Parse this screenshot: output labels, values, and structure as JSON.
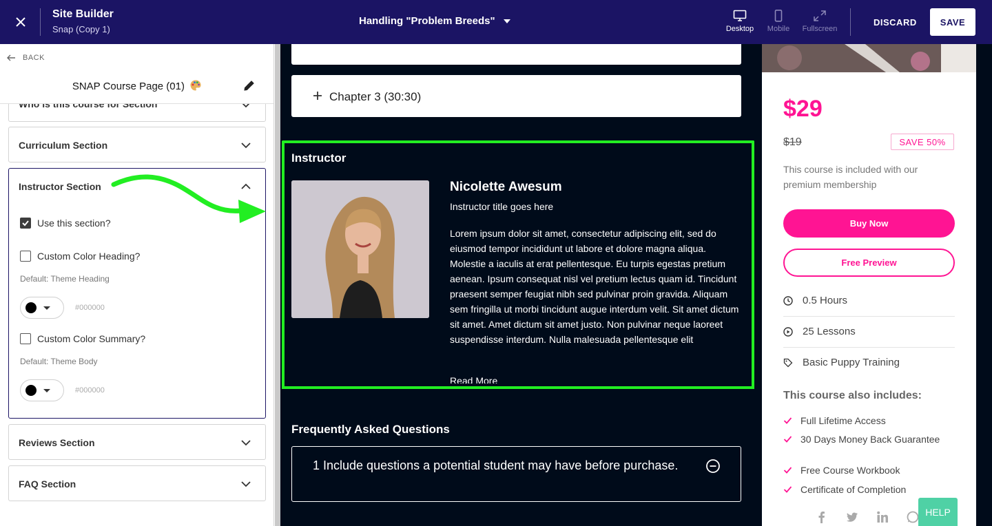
{
  "topbar": {
    "app_title": "Site Builder",
    "app_subtitle": "Snap (Copy 1)",
    "page_selector": "Handling \"Problem Breeds\"",
    "views": [
      {
        "label": "Desktop",
        "icon": "desktop-icon",
        "active": true
      },
      {
        "label": "Mobile",
        "icon": "mobile-icon",
        "active": false
      },
      {
        "label": "Fullscreen",
        "icon": "fullscreen-icon",
        "active": false
      }
    ],
    "discard_label": "DISCARD",
    "save_label": "SAVE"
  },
  "sidebar": {
    "back_label": "BACK",
    "page_name": "SNAP Course Page (01)",
    "sections": [
      {
        "label": "Who is this course for Section",
        "state": "collapsed"
      },
      {
        "label": "Curriculum Section",
        "state": "collapsed"
      },
      {
        "label": "Instructor Section",
        "state": "expanded"
      },
      {
        "label": "Reviews Section",
        "state": "collapsed"
      },
      {
        "label": "FAQ Section",
        "state": "collapsed"
      }
    ],
    "instructor_section": {
      "use_section_label": "Use this section?",
      "use_section_checked": true,
      "custom_heading_label": "Custom Color Heading?",
      "custom_heading_checked": false,
      "heading_default": "Default: Theme Heading",
      "heading_color": "#000000",
      "custom_summary_label": "Custom Color Summary?",
      "custom_summary_checked": false,
      "summary_default": "Default: Theme Body",
      "summary_color": "#000000"
    }
  },
  "preview": {
    "chapter_label": "Chapter 3 (30:30)",
    "instructor": {
      "heading": "Instructor",
      "name": "Nicolette Awesum",
      "title": "Instructor title goes here",
      "bio": "Lorem ipsum dolor sit amet, consectetur adipiscing elit, sed do eiusmod tempor incididunt ut labore et dolore magna aliqua. Molestie a iaculis at erat pellentesque. Eu turpis egestas pretium aenean. Ipsum consequat nisl vel pretium lectus quam id. Tincidunt praesent semper feugiat nibh sed pulvinar proin gravida. Aliquam sem fringilla ut morbi tincidunt augue interdum velit. Sit amet dictum sit amet. Amet dictum sit amet justo. Non pulvinar neque laoreet suspendisse interdum. Nulla malesuada pellentesque elit",
      "read_more": "Read More"
    },
    "faq": {
      "heading": "Frequently Asked Questions",
      "question": "1 Include questions a potential student may have before purchase."
    },
    "purchase_card": {
      "price": "$29",
      "old_price": "$19",
      "save_badge": "SAVE 50%",
      "included_text": "This course is included with our premium membership",
      "buy_label": "Buy Now",
      "preview_label": "Free Preview",
      "meta": [
        {
          "icon": "clock-icon",
          "text": "0.5 Hours"
        },
        {
          "icon": "play-circle-icon",
          "text": "25 Lessons"
        },
        {
          "icon": "tag-icon",
          "text": "Basic Puppy Training"
        }
      ],
      "also_heading": "This course also includes:",
      "features": [
        "Full Lifetime Access",
        "30 Days Money Back Guarantee",
        "Free Course Workbook",
        "Certificate of Completion"
      ],
      "social_icons": [
        "facebook-icon",
        "twitter-icon",
        "linkedin-icon",
        "whatsapp-icon"
      ]
    },
    "help_label": "HELP"
  },
  "colors": {
    "topbar_bg": "#1b1464",
    "accent_pink": "#ff1493",
    "highlight_green": "#22ee22",
    "preview_bg": "#000b1a",
    "help_bg": "#4fd1a5"
  }
}
